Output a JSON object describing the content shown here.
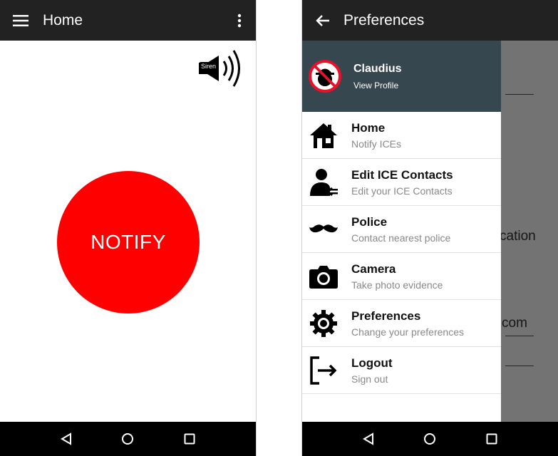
{
  "left_screen": {
    "title": "Home",
    "siren_label": "Siren",
    "notify_label": "NOTIFY"
  },
  "right_screen": {
    "title": "Preferences",
    "profile": {
      "name": "Claudius",
      "subtitle": "View Profile"
    },
    "menu": [
      {
        "title": "Home",
        "subtitle": "Notify ICEs",
        "icon": "home-icon"
      },
      {
        "title": "Edit ICE Contacts",
        "subtitle": "Edit your ICE Contacts",
        "icon": "contact-edit-icon"
      },
      {
        "title": "Police",
        "subtitle": "Contact nearest police",
        "icon": "mustache-icon"
      },
      {
        "title": "Camera",
        "subtitle": "Take photo evidence",
        "icon": "camera-icon"
      },
      {
        "title": "Preferences",
        "subtitle": "Change your preferences",
        "icon": "gear-icon"
      },
      {
        "title": "Logout",
        "subtitle": "Sign out",
        "icon": "logout-icon"
      }
    ],
    "background_fragments": [
      "cation",
      "com"
    ]
  },
  "colors": {
    "appbar": "#222222",
    "drawer_header": "#37474f",
    "notify_button": "#ff0000",
    "navbar": "#000000"
  }
}
